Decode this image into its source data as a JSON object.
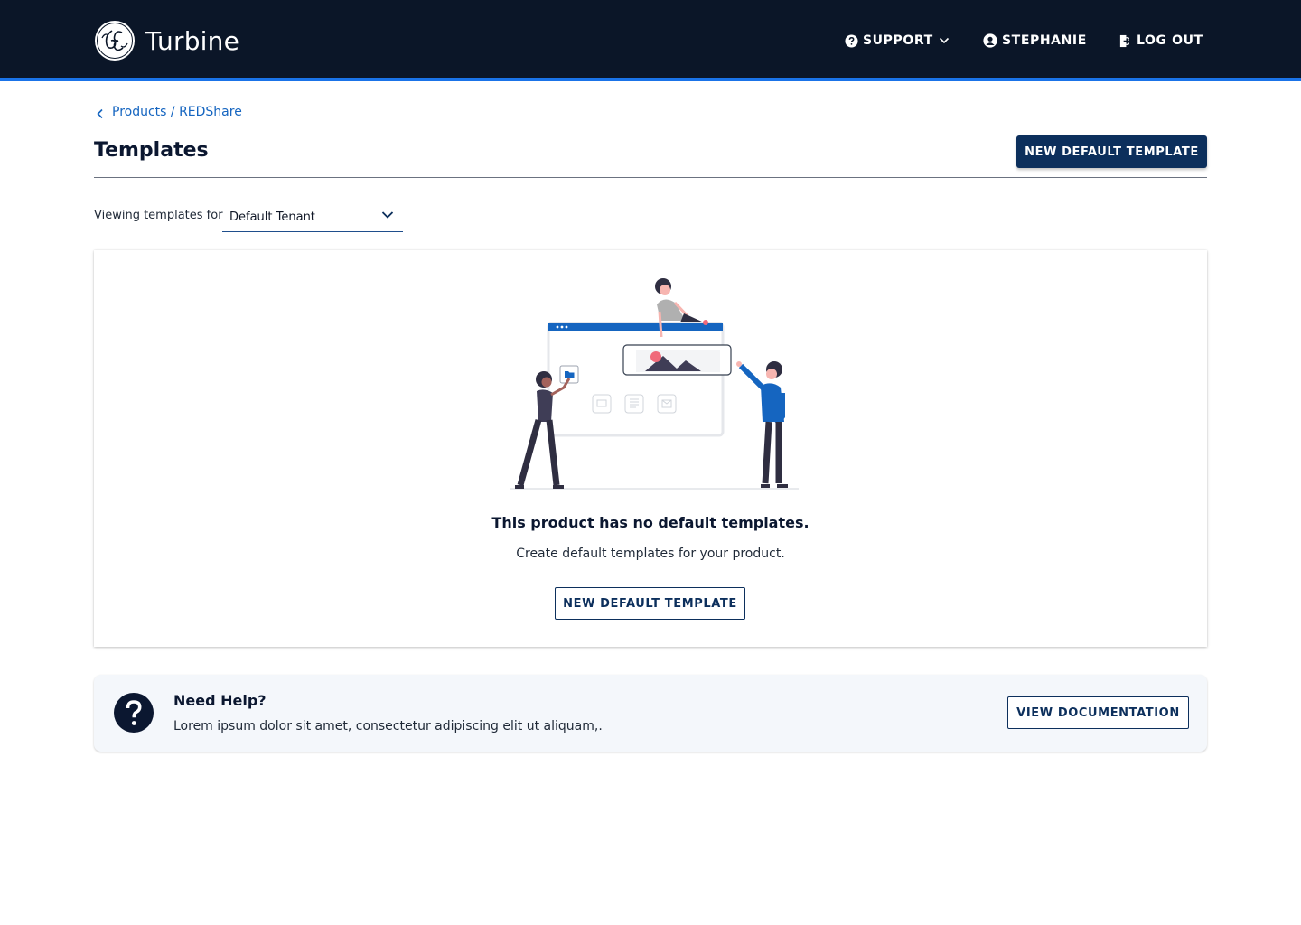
{
  "header": {
    "brand_name": "Turbine",
    "logo_icon": "ge-logo-icon",
    "nav": {
      "support_label": "SUPPORT",
      "user_label": "STEPHANIE",
      "logout_label": "LOG OUT"
    },
    "accent_color": "#1a73e8",
    "background_color": "#0b1628"
  },
  "breadcrumb": {
    "link_label": "Products / REDShare"
  },
  "page": {
    "title": "Templates",
    "primary_button_label": "NEW DEFAULT TEMPLATE"
  },
  "filter": {
    "label": "Viewing templates for",
    "selected_value": "Default Tenant"
  },
  "empty_state": {
    "title": "This product has no default templates.",
    "subtitle": "Create default templates for your product.",
    "button_label": "NEW DEFAULT TEMPLATE"
  },
  "help": {
    "title": "Need Help?",
    "text": "Lorem ipsum dolor sit amet, consectetur adipiscing elit ut aliquam,.",
    "button_label": "VIEW DOCUMENTATION"
  },
  "colors": {
    "primary": "#0c2f5c",
    "link": "#1565c0"
  }
}
